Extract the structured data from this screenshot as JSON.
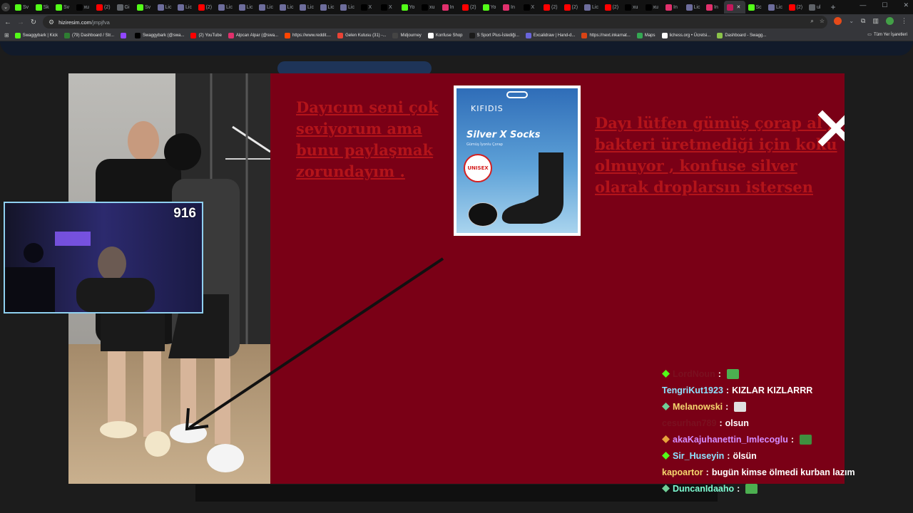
{
  "browser": {
    "tabs": [
      {
        "icon": "kick-icon",
        "label": "Sv",
        "color": "#53fc18"
      },
      {
        "icon": "kick-icon",
        "label": "Sk",
        "color": "#53fc18"
      },
      {
        "icon": "kick-icon",
        "label": "Sv",
        "color": "#53fc18"
      },
      {
        "icon": "x-icon",
        "label": "xu",
        "color": "#000000"
      },
      {
        "icon": "youtube-icon",
        "label": "(2)",
        "color": "#ff0000"
      },
      {
        "icon": "page-icon",
        "label": "Gi",
        "color": "#5f6368"
      },
      {
        "icon": "kick-icon",
        "label": "Sv",
        "color": "#53fc18"
      },
      {
        "icon": "feather-icon",
        "label": "Lic",
        "color": "#6d6d9c"
      },
      {
        "icon": "feather-icon",
        "label": "Lic",
        "color": "#6d6d9c"
      },
      {
        "icon": "youtube-icon",
        "label": "(2)",
        "color": "#ff0000"
      },
      {
        "icon": "feather-icon",
        "label": "Lic",
        "color": "#6d6d9c"
      },
      {
        "icon": "feather-icon",
        "label": "Lic",
        "color": "#6d6d9c"
      },
      {
        "icon": "feather-icon",
        "label": "Lic",
        "color": "#6d6d9c"
      },
      {
        "icon": "feather-icon",
        "label": "Lic",
        "color": "#6d6d9c"
      },
      {
        "icon": "feather-icon",
        "label": "Lic",
        "color": "#6d6d9c"
      },
      {
        "icon": "feather-icon",
        "label": "Lic",
        "color": "#6d6d9c"
      },
      {
        "icon": "feather-icon",
        "label": "Lic",
        "color": "#6d6d9c"
      },
      {
        "icon": "x-icon",
        "label": "X",
        "color": "#000000"
      },
      {
        "icon": "x-icon",
        "label": "X",
        "color": "#000000"
      },
      {
        "icon": "kick-icon",
        "label": "Yo",
        "color": "#53fc18"
      },
      {
        "icon": "x-icon",
        "label": "xu",
        "color": "#000000"
      },
      {
        "icon": "instagram-icon",
        "label": "In",
        "color": "#e1306c"
      },
      {
        "icon": "youtube-icon",
        "label": "(2)",
        "color": "#ff0000"
      },
      {
        "icon": "kick-icon",
        "label": "Yo",
        "color": "#53fc18"
      },
      {
        "icon": "instagram-icon",
        "label": "In",
        "color": "#e1306c"
      },
      {
        "icon": "x-icon",
        "label": "X",
        "color": "#000000"
      },
      {
        "icon": "youtube-icon",
        "label": "(2)",
        "color": "#ff0000"
      },
      {
        "icon": "youtube-icon",
        "label": "(2)",
        "color": "#ff0000"
      },
      {
        "icon": "feather-icon",
        "label": "Lic",
        "color": "#6d6d9c"
      },
      {
        "icon": "youtube-icon",
        "label": "(2)",
        "color": "#ff0000"
      },
      {
        "icon": "x-icon",
        "label": "xu",
        "color": "#000000"
      },
      {
        "icon": "x-icon",
        "label": "xu",
        "color": "#000000"
      },
      {
        "icon": "instagram-icon",
        "label": "In",
        "color": "#e1306c"
      },
      {
        "icon": "feather-icon",
        "label": "Lic",
        "color": "#6d6d9c"
      },
      {
        "icon": "instagram-icon",
        "label": "In",
        "color": "#e1306c"
      },
      {
        "icon": "site-icon",
        "label": "",
        "color": "#c2185b",
        "active": true
      },
      {
        "icon": "kick-icon",
        "label": "Sc",
        "color": "#53fc18"
      },
      {
        "icon": "feather-icon",
        "label": "Lic",
        "color": "#6d6d9c"
      },
      {
        "icon": "youtube-icon",
        "label": "(2)",
        "color": "#ff0000"
      },
      {
        "icon": "page-icon",
        "label": "ul",
        "color": "#5f6368"
      }
    ],
    "url_host": "hiziresim.com",
    "url_path": "/jmpjfva",
    "bookmarks": [
      {
        "icon": "kick-icon",
        "label": "Swaggybark | Kick",
        "color": "#53fc18"
      },
      {
        "icon": "dashboard-icon",
        "label": "(79) Dashboard / Str...",
        "color": "#2e7d32"
      },
      {
        "icon": "twitch-icon",
        "label": "",
        "color": "#9146ff"
      },
      {
        "icon": "x-icon",
        "label": "Swaggybark (@swa...",
        "color": "#000000"
      },
      {
        "icon": "youtube-icon",
        "label": "(2) YouTube",
        "color": "#ff0000"
      },
      {
        "icon": "instagram-icon",
        "label": "Alpcan Alpar (@swa...",
        "color": "#e1306c"
      },
      {
        "icon": "reddit-icon",
        "label": "https://www.reddit....",
        "color": "#ff4500"
      },
      {
        "icon": "gmail-icon",
        "label": "Gelen Kutusu (31) -...",
        "color": "#ea4335"
      },
      {
        "icon": "midjourney-icon",
        "label": "Midjourney",
        "color": "#444444"
      },
      {
        "icon": "shop-icon",
        "label": "Konfuse Shop",
        "color": "#ffffff"
      },
      {
        "icon": "sport-icon",
        "label": "S Sport Plus-İstediği...",
        "color": "#1a1a1a"
      },
      {
        "icon": "excalidraw-icon",
        "label": "Excalidraw | Hand-d...",
        "color": "#6965db"
      },
      {
        "icon": "link-icon",
        "label": "https://next.inkarnat...",
        "color": "#d84315"
      },
      {
        "icon": "maps-icon",
        "label": "Maps",
        "color": "#34a853"
      },
      {
        "icon": "lichess-icon",
        "label": "lichess.org • Ücretsi...",
        "color": "#ffffff"
      },
      {
        "icon": "dashboard-icon",
        "label": "Dashboard - Swagg...",
        "color": "#8bc34a"
      }
    ],
    "all_bookmarks": "Tüm Yer İşaretleri"
  },
  "overlay": {
    "left_text": "Dayıcım seni çok seviyorum ama bunu paylaşmak zorundayım .",
    "right_text": "Dayı lütfen gümüş çorap al , bakteri üretmediği için koku olmuyor , konfuse silver olarak droplarsın istersen",
    "product": {
      "brand": "KIFIDIS",
      "name": "Silver X Socks",
      "subtitle": "Gümüş İyonlu Çorap",
      "badge": "UNISEX"
    },
    "bg_color": "#7a0016",
    "text_color": "#b3141a"
  },
  "webcam": {
    "viewer_count": "916"
  },
  "chat": [
    {
      "badge": "verified-badge-icon",
      "badge_color": "#53fc18",
      "user": "LordNoun",
      "user_color": "#7a1020",
      "sep": ":",
      "text": "",
      "emote": "emote-icon",
      "emote_color": "#4caf50"
    },
    {
      "badge": "",
      "badge_color": "",
      "user": "TengriKut1923",
      "user_color": "#8fe3ff",
      "sep": ":",
      "text": "KIZLAR KIZLARRR",
      "emote": "",
      "emote_color": ""
    },
    {
      "badge": "sub-badge-icon",
      "badge_color": "#6fcf97",
      "user": "Melanowski",
      "user_color": "#f5d76e",
      "sep": ":",
      "text": "",
      "emote": "image-icon",
      "emote_color": "#e0e0e0"
    },
    {
      "badge": "",
      "badge_color": "",
      "user": "cesurhan789",
      "user_color": "#7a1020",
      "sep": ":",
      "text": "olsun",
      "emote": "",
      "emote_color": ""
    },
    {
      "badge": "sub-badge-icon",
      "badge_color": "#e6a23c",
      "user": "akaKajuhanettin_Imlecoglu",
      "user_color": "#d58cff",
      "sep": ":",
      "text": "",
      "emote": "pepe-emote-icon",
      "emote_color": "#3f8f3f"
    },
    {
      "badge": "verified-badge-icon",
      "badge_color": "#53fc18",
      "user": "Sir_Huseyin",
      "user_color": "#8fe3ff",
      "sep": ":",
      "text": "ölsün",
      "emote": "",
      "emote_color": ""
    },
    {
      "badge": "",
      "badge_color": "",
      "user": "kapoartor",
      "user_color": "#f5d76e",
      "sep": ":",
      "text": "bugün kimse ölmedi kurban lazım",
      "emote": "",
      "emote_color": ""
    },
    {
      "badge": "sub-badge-icon",
      "badge_color": "#6fcf97",
      "user": "DuncanIdaaho",
      "user_color": "#7fffd4",
      "sep": ":",
      "text": "",
      "emote": "emote-icon",
      "emote_color": "#4caf50"
    }
  ]
}
